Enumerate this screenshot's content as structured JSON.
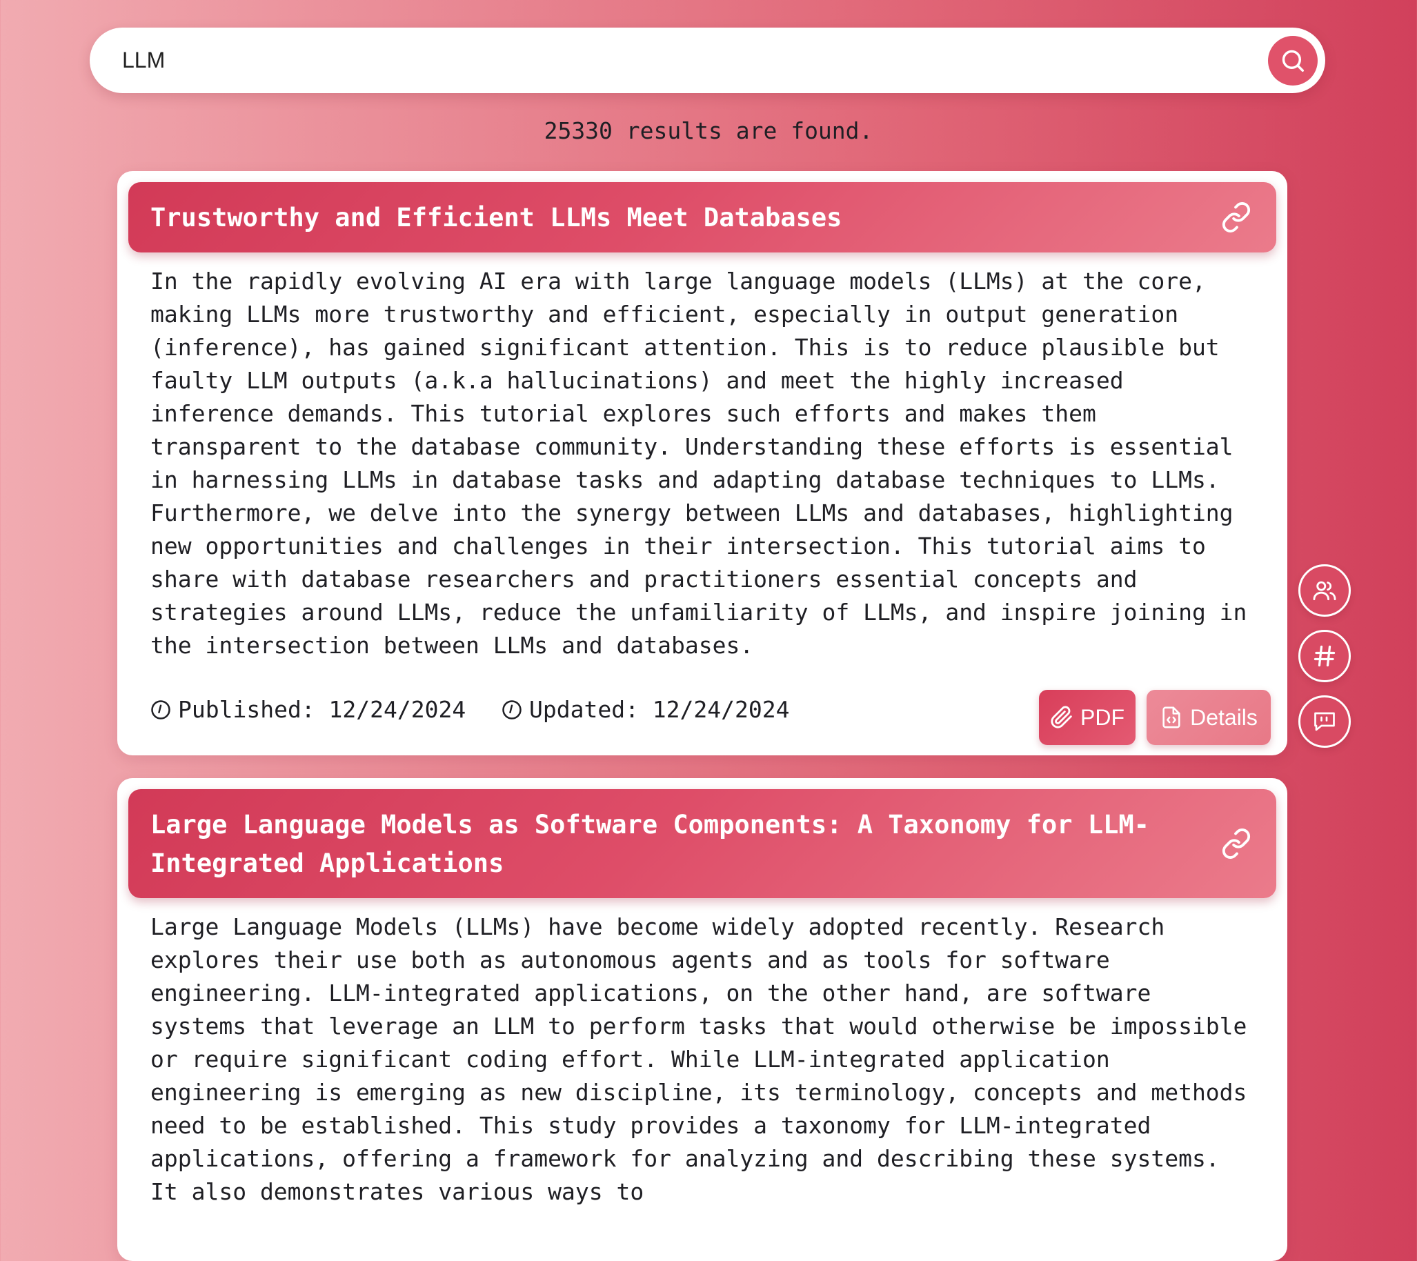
{
  "search": {
    "query": "LLM",
    "button_icon": "search-icon"
  },
  "results_count_text": "25330 results are found.",
  "results": [
    {
      "title": "Trustworthy and Efficient LLMs Meet Databases",
      "abstract": "In the rapidly evolving AI era with large language models (LLMs) at the core, making LLMs more trustworthy and efficient, especially in output generation (inference), has gained significant attention. This is to reduce plausible but faulty LLM outputs (a.k.a hallucinations) and meet the highly increased inference demands. This tutorial explores such efforts and makes them transparent to the database community. Understanding these efforts is essential in harnessing LLMs in database tasks and adapting database techniques to LLMs. Furthermore, we delve into the synergy between LLMs and databases, highlighting new opportunities and challenges in their intersection. This tutorial aims to share with database researchers and practitioners essential concepts and strategies around LLMs, reduce the unfamiliarity of LLMs, and inspire joining in the intersection between LLMs and databases.",
      "published": "Published: 12/24/2024",
      "updated": "Updated: 12/24/2024",
      "pdf_label": "PDF",
      "details_label": "Details"
    },
    {
      "title": "Large Language Models as Software Components: A Taxonomy for LLM-Integrated Applications",
      "abstract": "Large Language Models (LLMs) have become widely adopted recently. Research explores their use both as autonomous agents and as tools for software engineering. LLM-integrated applications, on the other hand, are software systems that leverage an LLM to perform tasks that would otherwise be impossible or require significant coding effort. While LLM-integrated application engineering is emerging as new discipline, its terminology, concepts and methods need to be established. This study provides a taxonomy for LLM-integrated applications, offering a framework for analyzing and describing these systems. It also demonstrates various ways to"
    }
  ],
  "floating_actions": [
    {
      "icon": "users-icon"
    },
    {
      "icon": "hashtag-icon"
    },
    {
      "icon": "chat-quote-icon"
    }
  ],
  "colors": {
    "accent": "#e0526a",
    "header_gradient_start": "#d23a57",
    "header_gradient_end": "#eb7b8b",
    "background_left": "#f1abb1",
    "background_right": "#d1405b"
  }
}
